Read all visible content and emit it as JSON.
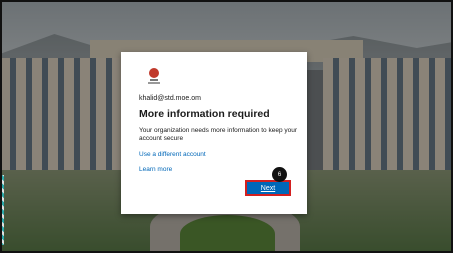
{
  "dialog": {
    "account": "khalid@std.moe.om",
    "title": "More information required",
    "description": "Your organization needs more information to keep your account secure",
    "link_alt": "Use a different account",
    "link_learn": "Learn more",
    "next_label": "Next"
  },
  "annotation": {
    "step_number": "6"
  },
  "colors": {
    "accent": "#0067b8",
    "highlight": "#d32020"
  }
}
